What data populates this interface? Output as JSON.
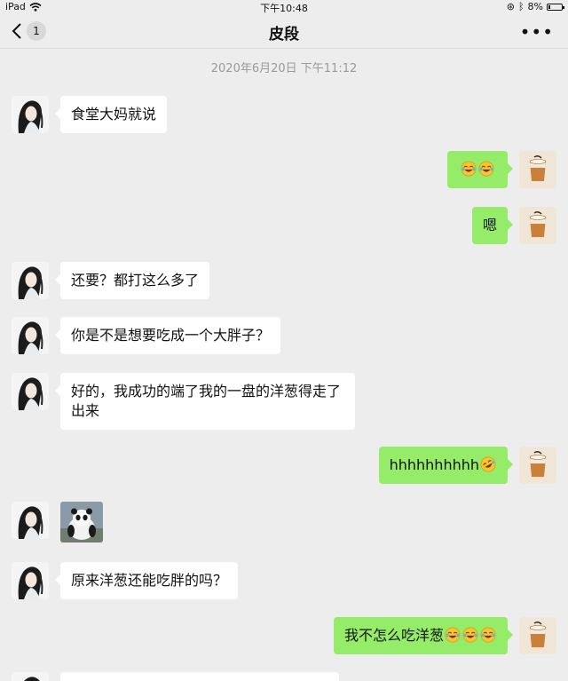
{
  "status": {
    "device": "iPad",
    "time": "下午10:48",
    "battery": "8%"
  },
  "header": {
    "unread_count": "1",
    "title": "皮段"
  },
  "timestamp": "2020年6月20日 下午11:12",
  "messages": [
    {
      "side": "left",
      "text": "食堂大妈就说"
    },
    {
      "side": "right",
      "emojis": [
        "laugh-cry",
        "laugh-cry"
      ]
    },
    {
      "side": "right",
      "text": "嗯"
    },
    {
      "side": "left",
      "text": "还要？都打这么多了"
    },
    {
      "side": "left",
      "text": "你是不是想要吃成一个大胖子？"
    },
    {
      "side": "left",
      "text": "好的，我成功的端了我的一盘的洋葱得走了出来"
    },
    {
      "side": "right",
      "text": "hhhhhhhhhh",
      "emojis": [
        "rolling-laugh"
      ]
    },
    {
      "side": "left",
      "sticker": "panda-sticker"
    },
    {
      "side": "left",
      "text": "原来洋葱还能吃胖的吗？"
    },
    {
      "side": "right",
      "text": "我不怎么吃洋葱",
      "emojis": [
        "laugh-cry",
        "laugh-cry",
        "laugh-cry"
      ]
    }
  ],
  "colors": {
    "background": "#ededed",
    "bubble_self": "#95ec69",
    "bubble_other": "#ffffff"
  }
}
